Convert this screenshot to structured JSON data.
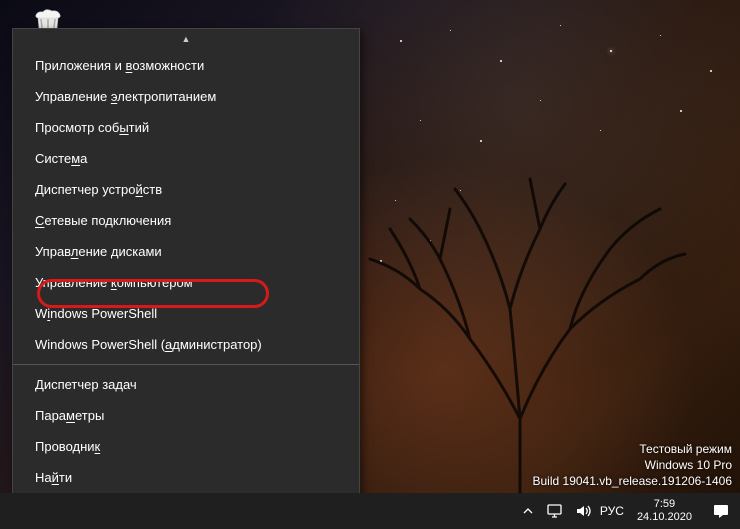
{
  "desktop": {
    "recycle_bin_name": "recycle-bin"
  },
  "menu": {
    "items": [
      {
        "pre": "Приложения и ",
        "u": "в",
        "post": "озможности"
      },
      {
        "pre": "Управление ",
        "u": "э",
        "post": "лектропитанием"
      },
      {
        "pre": "Просмотр соб",
        "u": "ы",
        "post": "тий"
      },
      {
        "pre": "Систе",
        "u": "м",
        "post": "а"
      },
      {
        "pre": "Диспетчер устро",
        "u": "й",
        "post": "ств"
      },
      {
        "pre": "",
        "u": "С",
        "post": "етевые подключения"
      },
      {
        "pre": "Управ",
        "u": "л",
        "post": "ение дисками"
      },
      {
        "pre": "Управление ",
        "u": "к",
        "post": "омпьютером"
      },
      {
        "pre": "W",
        "u": "i",
        "post": "ndows PowerShell"
      },
      {
        "pre": "Windows PowerShell (",
        "u": "а",
        "post": "дминистратор)"
      },
      {
        "pre": "",
        "u": "Д",
        "post": "испетчер задач"
      },
      {
        "pre": "Пара",
        "u": "м",
        "post": "етры"
      },
      {
        "pre": "Проводни",
        "u": "к",
        "post": ""
      },
      {
        "pre": "На",
        "u": "й",
        "post": "ти"
      }
    ],
    "divider_after": [
      9
    ],
    "highlighted_index": 6
  },
  "watermark": {
    "line1": "Тестовый режим",
    "line2": "Windows 10 Pro",
    "line3": "Build 19041.vb_release.191206-1406"
  },
  "taskbar": {
    "language": "РУС",
    "time": "7:59",
    "date": "24.10.2020"
  }
}
